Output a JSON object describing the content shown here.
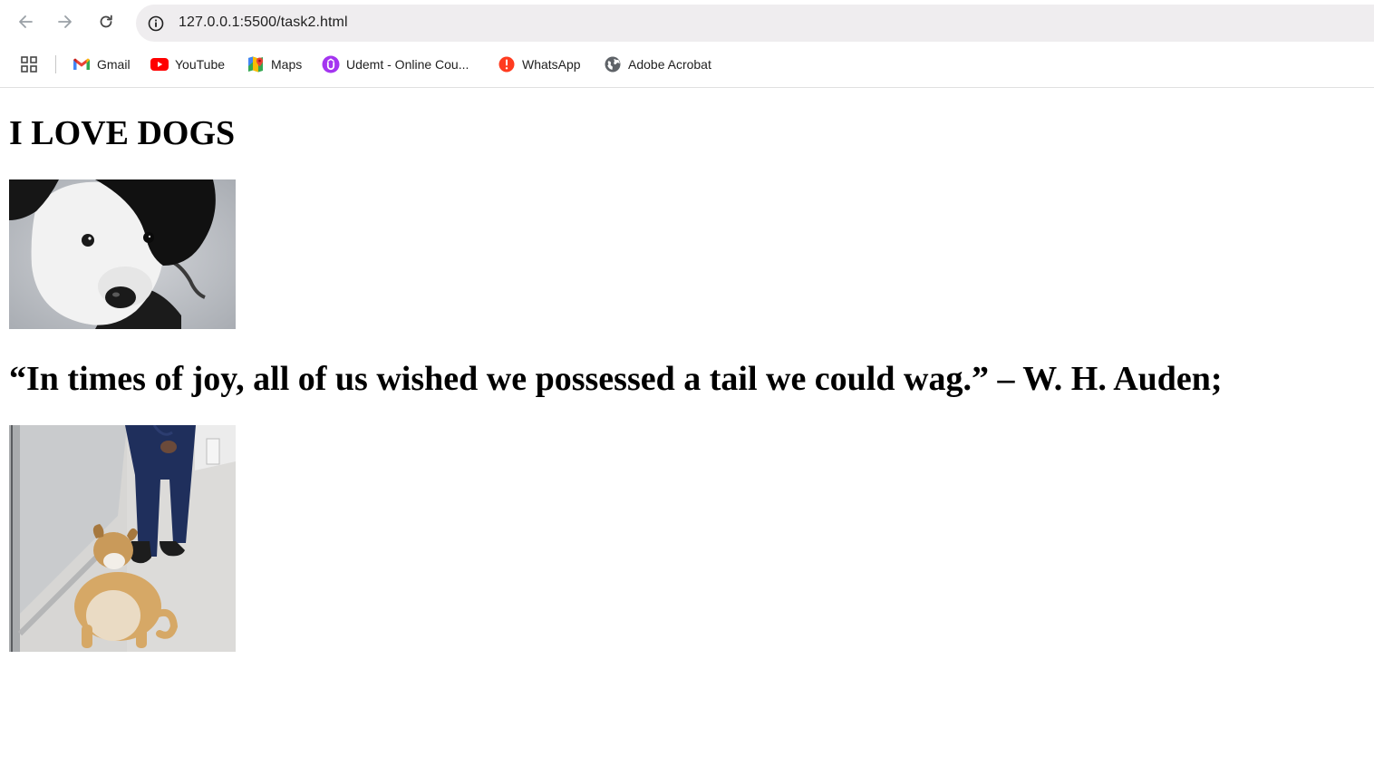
{
  "browser": {
    "url": "127.0.0.1:5500/task2.html",
    "nav": {
      "back_icon": "arrow-left-icon",
      "forward_icon": "arrow-right-icon",
      "reload_icon": "reload-icon",
      "site_info_icon": "info-icon"
    },
    "bookmarks": [
      {
        "label": "Gmail",
        "icon": "gmail-icon",
        "color": "#ea4335"
      },
      {
        "label": "YouTube",
        "icon": "youtube-icon",
        "color": "#ff0000"
      },
      {
        "label": "Maps",
        "icon": "maps-icon",
        "color": "#34a853"
      },
      {
        "label": "Udemt - Online Cou...",
        "icon": "udemy-icon",
        "color": "#a435f0"
      },
      {
        "label": "WhatsApp",
        "icon": "whatsapp-icon",
        "color": "#ff3b1f"
      },
      {
        "label": "Adobe Acrobat",
        "icon": "globe-icon",
        "color": "#5f6368"
      }
    ]
  },
  "page": {
    "title": "I LOVE DOGS",
    "quote": "“In times of joy, all of us wished we possessed a tail we could wag.” – W. H. Auden;",
    "images": [
      {
        "name": "black-and-white-puppy-photo"
      },
      {
        "name": "dog-and-person-hallway-photo"
      }
    ]
  }
}
